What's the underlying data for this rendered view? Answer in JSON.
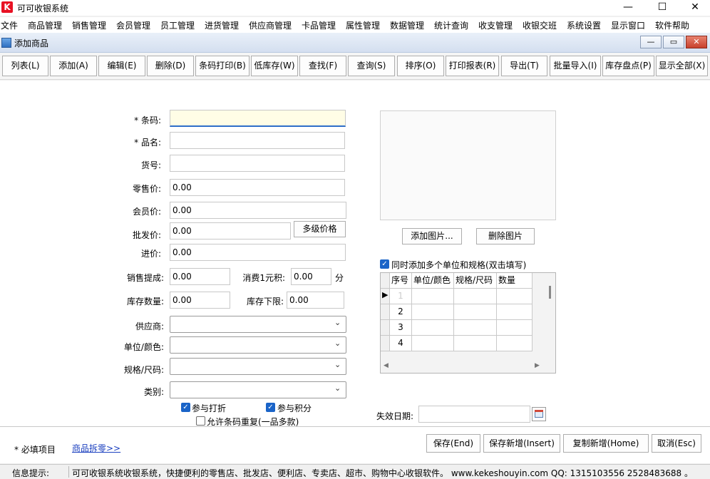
{
  "app": {
    "logo_glyph": "K",
    "title": "可可收银系统",
    "win_minimize": "—",
    "win_maximize": "☐",
    "win_close": "✕"
  },
  "menu": [
    "文件",
    "商品管理",
    "销售管理",
    "会员管理",
    "员工管理",
    "进货管理",
    "供应商管理",
    "卡品管理",
    "属性管理",
    "数据管理",
    "统计查询",
    "收支管理",
    "收银交班",
    "系统设置",
    "显示窗口",
    "软件帮助"
  ],
  "child_window": {
    "title": "添加商品",
    "min": "—",
    "restore": "▭",
    "close": "✕"
  },
  "toolbar": [
    "列表(L)",
    "添加(A)",
    "编辑(E)",
    "删除(D)",
    "条码打印(B)",
    "低库存(W)",
    "查找(F)",
    "查询(S)",
    "排序(O)",
    "打印报表(R)",
    "导出(T)",
    "批量导入(I)",
    "库存盘点(P)",
    "显示全部(X)"
  ],
  "form": {
    "barcode_label": "* 条码:",
    "name_label": "* 品名:",
    "itemno_label": "货号:",
    "retail_label": "零售价:",
    "retail_value": "0.00",
    "member_label": "会员价:",
    "member_value": "0.00",
    "wholesale_label": "批发价:",
    "wholesale_value": "0.00",
    "multilevel_button": "多级价格",
    "purchase_label": "进价:",
    "purchase_value": "0.00",
    "commission_label": "销售提成:",
    "commission_value": "0.00",
    "points_label": "消费1元积:",
    "points_value": "0.00",
    "points_unit": "分",
    "stock_label": "库存数量:",
    "stock_value": "0.00",
    "minstock_label": "库存下限:",
    "minstock_value": "0.00",
    "supplier_label": "供应商:",
    "unit_label": "单位/颜色:",
    "spec_label": "规格/尺码:",
    "category_label": "类别:",
    "discount_label": "参与打折",
    "points_check_label": "参与积分",
    "dup_label": "允许条码重复(一品多款)",
    "expire_label": "失效日期:"
  },
  "image": {
    "add_button": "添加图片...",
    "delete_button": "删除图片"
  },
  "multi": {
    "label": "同时添加多个单位和规格(双击填写)",
    "columns": [
      "序号",
      "单位/颜色",
      "规格/尺码",
      "数量"
    ],
    "rows": [
      "1",
      "2",
      "3",
      "4"
    ]
  },
  "bottom": {
    "required_note": "* 必填项目",
    "split_link": "商品拆零>>",
    "save_button": "保存(End)",
    "save_new_button": "保存新增(Insert)",
    "copy_new_button": "复制新增(Home)",
    "cancel_button": "取消(Esc)"
  },
  "status": {
    "label": "信息提示:",
    "text": "可可收银系统收银系统，快捷便利的零售店、批发店、便利店、专卖店、超市、购物中心收银软件。 www.kekeshouyin.com QQ: 1315103556 2528483688 。"
  }
}
